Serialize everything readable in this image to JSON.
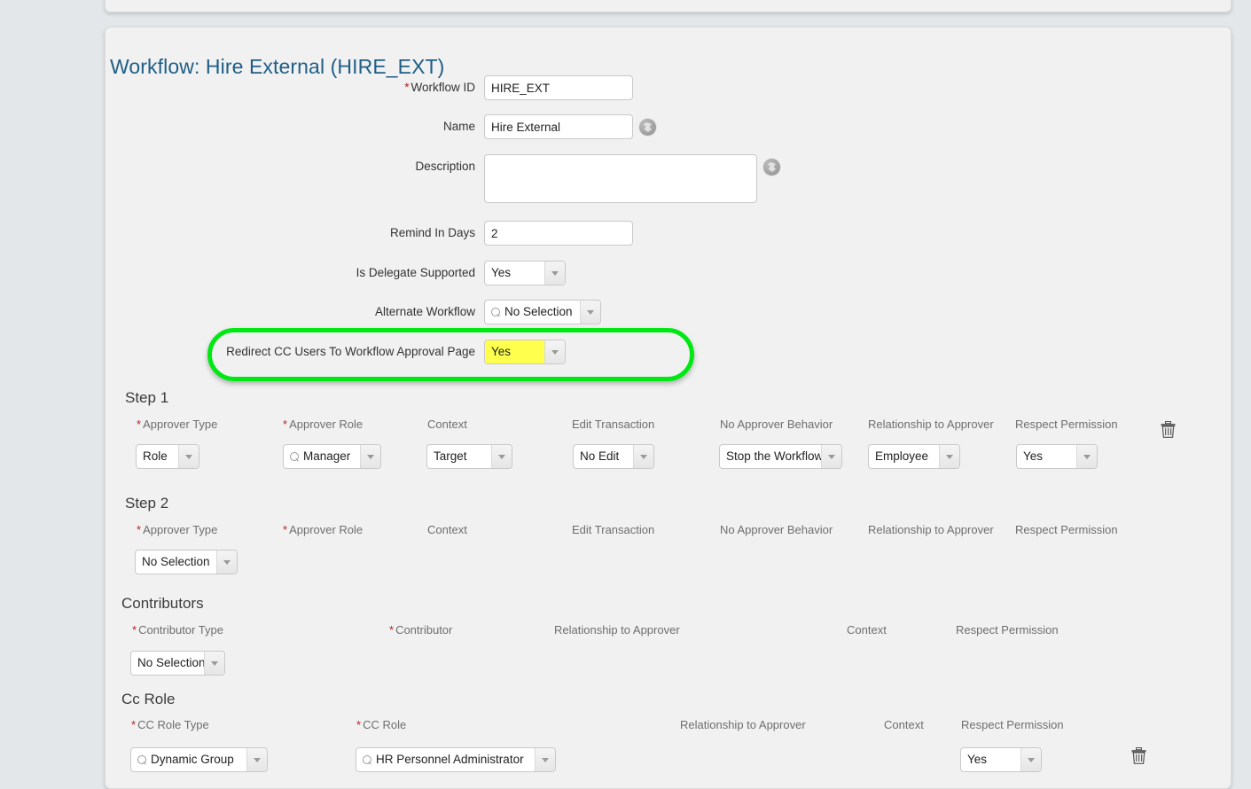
{
  "page": {
    "title": "Workflow: Hire External (HIRE_EXT)",
    "background_color": "#e3e7e9",
    "panel_color": "#f1f1f1",
    "title_color": "#1f5e86",
    "highlight_color": "#ffff4d",
    "annotation_color": "#00e813"
  },
  "form": {
    "workflow_id": {
      "label": "Workflow ID",
      "required": true,
      "value": "HIRE_EXT"
    },
    "name": {
      "label": "Name",
      "required": false,
      "value": "Hire External",
      "icon": "globe-icon"
    },
    "description": {
      "label": "Description",
      "required": false,
      "value": "",
      "icon": "globe-icon"
    },
    "remind_in_days": {
      "label": "Remind In Days",
      "required": false,
      "value": "2"
    },
    "is_delegate_supported": {
      "label": "Is Delegate Supported",
      "required": false,
      "value": "Yes"
    },
    "alternate_workflow": {
      "label": "Alternate Workflow",
      "required": false,
      "value": "No Selection",
      "icon": "search-icon"
    },
    "redirect_cc_users": {
      "label": "Redirect CC Users To Workflow Approval Page",
      "required": false,
      "value": "Yes",
      "highlighted": true
    }
  },
  "step1": {
    "title": "Step 1",
    "columns": [
      {
        "label": "Approver Type",
        "required": true
      },
      {
        "label": "Approver Role",
        "required": true
      },
      {
        "label": "Context",
        "required": false
      },
      {
        "label": "Edit Transaction",
        "required": false
      },
      {
        "label": "No Approver Behavior",
        "required": false
      },
      {
        "label": "Relationship to Approver",
        "required": false
      },
      {
        "label": "Respect Permission",
        "required": false
      }
    ],
    "values": [
      {
        "value": "Role",
        "icon": ""
      },
      {
        "value": "Manager",
        "icon": "search-icon"
      },
      {
        "value": "Target",
        "icon": ""
      },
      {
        "value": "No Edit",
        "icon": ""
      },
      {
        "value": "Stop the Workflow",
        "icon": ""
      },
      {
        "value": "Employee",
        "icon": ""
      },
      {
        "value": "Yes",
        "icon": ""
      }
    ],
    "delete_icon": "trash-icon"
  },
  "step2": {
    "title": "Step 2",
    "columns": [
      {
        "label": "Approver Type",
        "required": true
      },
      {
        "label": "Approver Role",
        "required": true
      },
      {
        "label": "Context",
        "required": false
      },
      {
        "label": "Edit Transaction",
        "required": false
      },
      {
        "label": "No Approver Behavior",
        "required": false
      },
      {
        "label": "Relationship to Approver",
        "required": false
      },
      {
        "label": "Respect Permission",
        "required": false
      }
    ],
    "values": [
      {
        "value": "No Selection",
        "icon": ""
      }
    ]
  },
  "contributors": {
    "title": "Contributors",
    "columns": [
      {
        "label": "Contributor Type",
        "required": true
      },
      {
        "label": "Contributor",
        "required": true
      },
      {
        "label": "Relationship to Approver",
        "required": false
      },
      {
        "label": "Context",
        "required": false
      },
      {
        "label": "Respect Permission",
        "required": false
      }
    ],
    "values": [
      {
        "value": "No Selection",
        "icon": ""
      }
    ]
  },
  "cc_role": {
    "title": "Cc Role",
    "columns": [
      {
        "label": "CC Role Type",
        "required": true
      },
      {
        "label": "CC Role",
        "required": true
      },
      {
        "label": "Relationship to Approver",
        "required": false
      },
      {
        "label": "Context",
        "required": false
      },
      {
        "label": "Respect Permission",
        "required": false
      }
    ],
    "values": [
      {
        "value": "Dynamic Group",
        "icon": "search-icon"
      },
      {
        "value": "HR Personnel Administrator",
        "icon": "search-icon"
      },
      {
        "value": "Yes",
        "icon": ""
      }
    ],
    "delete_icon": "trash-icon"
  }
}
